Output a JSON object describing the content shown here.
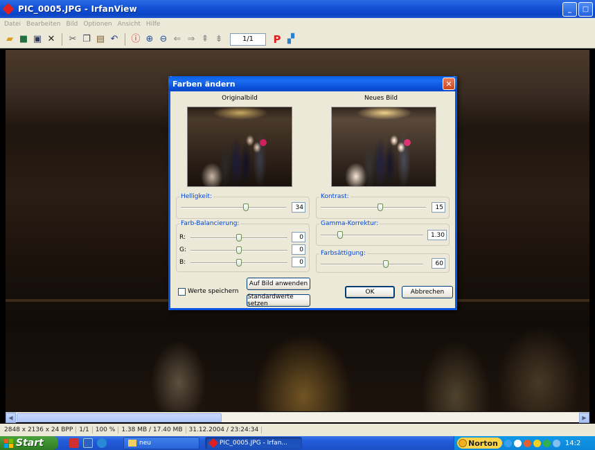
{
  "window": {
    "title": "PIC_0005.JPG - IrfanView",
    "controls": {
      "minimize": "_",
      "maximize": "□"
    }
  },
  "menu": [
    "Datei",
    "Bearbeiten",
    "Bild",
    "Optionen",
    "Ansicht",
    "Hilfe"
  ],
  "toolbar": {
    "page_indicator": "1/1",
    "icons": [
      "open-icon",
      "slideshow-icon",
      "save-icon",
      "delete-icon",
      "cut-icon",
      "copy-icon",
      "paste-icon",
      "undo-icon",
      "info-icon",
      "zoom-in-icon",
      "zoom-out-icon",
      "previous-icon",
      "next-icon",
      "first-icon",
      "last-icon",
      "p-icon",
      "paint-icon"
    ]
  },
  "dialog": {
    "title": "Farben ändern",
    "original_label": "Originalbild",
    "new_label": "Neues Bild",
    "brightness": {
      "label": "Helligkeit:",
      "value": "34"
    },
    "contrast": {
      "label": "Kontrast:",
      "value": "15"
    },
    "color_balance": {
      "label": "Farb-Balancierung:",
      "r_label": "R:",
      "r_value": "0",
      "g_label": "G:",
      "g_value": "0",
      "b_label": "B:",
      "b_value": "0"
    },
    "gamma": {
      "label": "Gamma-Korrektur:",
      "value": "1.30"
    },
    "saturation": {
      "label": "Farbsättigung:",
      "value": "60"
    },
    "save_values_label": "Werte speichern",
    "apply_button": "Auf Bild anwenden",
    "defaults_button": "Standardwerte setzen",
    "ok_button": "OK",
    "cancel_button": "Abbrechen"
  },
  "statusbar": {
    "dimensions": "2848 x 2136 x 24 BPP",
    "page": "1/1",
    "zoom": "100 %",
    "memory": "1.38 MB / 17.40 MB",
    "datetime": "31.12.2004 / 23:24:34"
  },
  "taskbar": {
    "start_label": "Start",
    "tasks": [
      {
        "label": "neu",
        "active": false
      },
      {
        "label": "PIC_0005.JPG - Irfan...",
        "active": true
      }
    ],
    "tray": {
      "norton_label": "Norton",
      "clock": "14:2"
    }
  }
}
